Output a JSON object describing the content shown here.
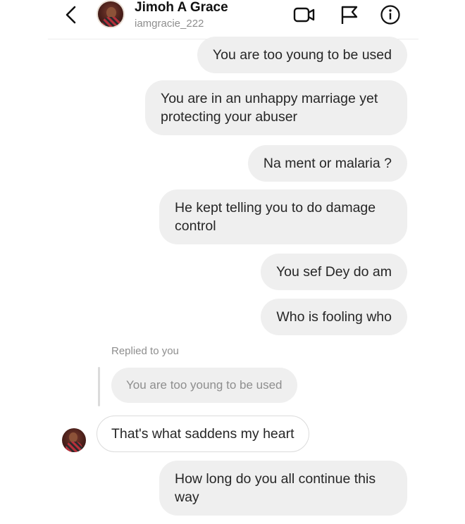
{
  "header": {
    "name": "Jimoh A Grace",
    "username": "iamgracie_222",
    "icons": [
      "back-icon",
      "video-call-icon",
      "flag-icon",
      "info-icon"
    ]
  },
  "messages": [
    {
      "direction": "outgoing",
      "text": "You are too young to be used"
    },
    {
      "direction": "outgoing",
      "text": "You are in an unhappy marriage yet protecting your abuser"
    },
    {
      "direction": "outgoing",
      "text": "Na ment or malaria ?"
    },
    {
      "direction": "outgoing",
      "text": "He kept telling you to do damage control"
    },
    {
      "direction": "outgoing",
      "text": "You sef Dey do am"
    },
    {
      "direction": "outgoing",
      "text": "Who is fooling who"
    }
  ],
  "reply": {
    "label": "Replied to you",
    "quoted_text": "You are too young to be used",
    "text": "That's what saddens my heart"
  },
  "last_message": {
    "direction": "outgoing",
    "text": "How long do you all continue this way"
  },
  "colors": {
    "bubble_bg": "#efefef",
    "text": "#262626",
    "muted": "#8e8e8e",
    "border": "#dbdbdb"
  }
}
